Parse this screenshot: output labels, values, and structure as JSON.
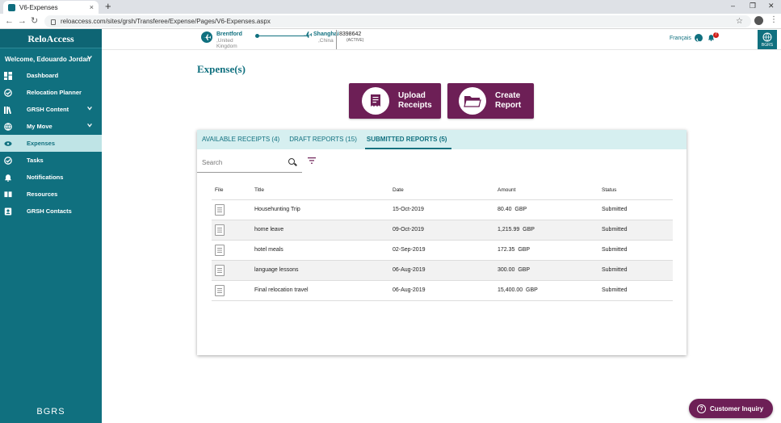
{
  "browser": {
    "tab_title": "V6-Expenses",
    "tab_close": "×",
    "new_tab": "+",
    "url": "reloaccess.com/sites/grsh/Transferee/Expense/Pages/V6-Expenses.aspx",
    "back": "←",
    "forward": "→",
    "reload": "↻",
    "star": "☆",
    "menu": "⋮",
    "minimize": "–",
    "maximize": "❐",
    "close": "✕"
  },
  "sidebar": {
    "brand": "ReloAccess",
    "welcome": "Welcome, Edouardo Jordan",
    "footer_logo": "BGRS",
    "items": [
      {
        "label": "Dashboard",
        "icon": "dashboard-icon",
        "chevron": false
      },
      {
        "label": "Relocation Planner",
        "icon": "planner-check-icon",
        "chevron": false
      },
      {
        "label": "GRSH Content",
        "icon": "library-icon",
        "chevron": true
      },
      {
        "label": "My Move",
        "icon": "globe-move-icon",
        "chevron": true
      },
      {
        "label": "Expenses",
        "icon": "expenses-icon",
        "chevron": false,
        "active": true
      },
      {
        "label": "Tasks",
        "icon": "tasks-check-icon",
        "chevron": false
      },
      {
        "label": "Notifications",
        "icon": "bell-icon",
        "chevron": false
      },
      {
        "label": "Resources",
        "icon": "book-icon",
        "chevron": false
      },
      {
        "label": "GRSH Contacts",
        "icon": "contacts-icon",
        "chevron": false
      }
    ]
  },
  "header": {
    "from_city": "Brentford",
    "from_country": ",United Kingdom",
    "to_city": "Shanghai",
    "to_country": ",China",
    "file_number": "8398642",
    "file_status": "(ACTIVE)",
    "language": "Français",
    "notification_count": "7",
    "logo": "BGRS"
  },
  "main": {
    "title": "Expense(s)",
    "upload_button": "Upload Receipts",
    "create_button": "Create Report",
    "tabs": [
      {
        "label": "AVAILABLE RECEIPTS (4)",
        "active": false
      },
      {
        "label": "DRAFT REPORTS (15)",
        "active": false
      },
      {
        "label": "SUBMITTED REPORTS (5)",
        "active": true
      }
    ],
    "search_placeholder": "Search",
    "columns": [
      "File",
      "Title",
      "Date",
      "Amount",
      "Status"
    ],
    "rows": [
      {
        "title": "Househunting Trip",
        "date": "15-Oct-2019",
        "amount": "80.40",
        "currency": "GBP",
        "status": "Submitted"
      },
      {
        "title": "home leave",
        "date": "09-Oct-2019",
        "amount": "1,215.99",
        "currency": "GBP",
        "status": "Submitted"
      },
      {
        "title": "hotel meals",
        "date": "02-Sep-2019",
        "amount": "172.35",
        "currency": "GBP",
        "status": "Submitted"
      },
      {
        "title": "language lessons",
        "date": "06-Aug-2019",
        "amount": "300.00",
        "currency": "GBP",
        "status": "Submitted"
      },
      {
        "title": "Final relocation travel",
        "date": "06-Aug-2019",
        "amount": "15,400.00",
        "currency": "GBP",
        "status": "Submitted"
      }
    ],
    "inquiry_button": "Customer Inquiry",
    "inquiry_glyph": "?"
  },
  "colors": {
    "teal": "#10707f",
    "plum": "#6d1f56",
    "tab_bg": "#d6eff0",
    "active_nav_bg": "#bfe4e6"
  }
}
